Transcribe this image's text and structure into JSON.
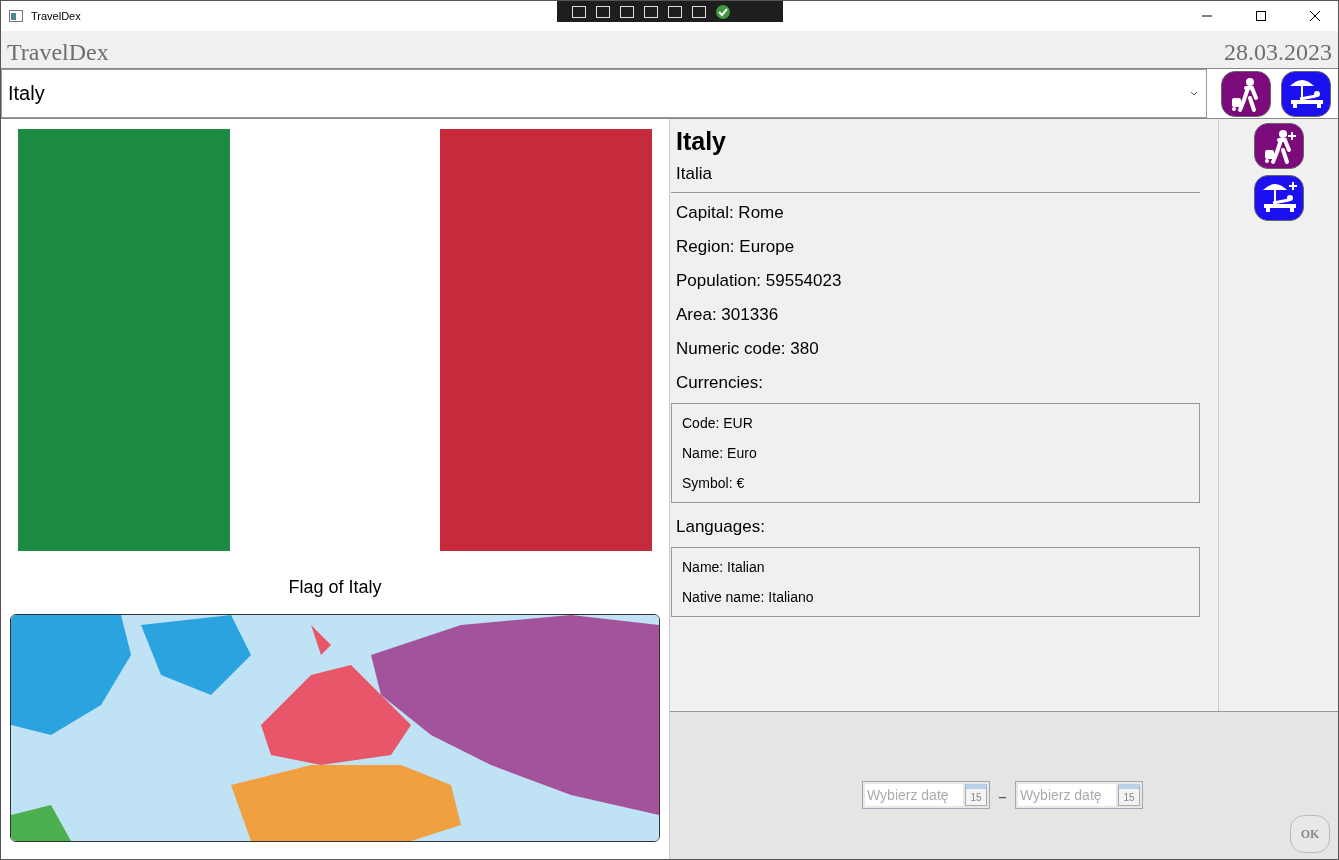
{
  "window": {
    "title": "TravelDex"
  },
  "header": {
    "app_name": "TravelDex",
    "date": "28.03.2023"
  },
  "country_select": {
    "value": "Italy"
  },
  "flag": {
    "caption": "Flag of Italy"
  },
  "details": {
    "name": "Italy",
    "native_name": "Italia",
    "facts": [
      "Capital: Rome",
      "Region: Europe",
      "Population: 59554023",
      "Area: 301336",
      "Numeric code: 380"
    ],
    "currencies_label": "Currencies:",
    "currencies": [
      [
        "Code: EUR",
        "Name: Euro",
        "Symbol: €"
      ]
    ],
    "languages_label": "Languages:",
    "languages": [
      [
        "Name: Italian",
        "Native name: Italiano"
      ]
    ]
  },
  "trip": {
    "start": {
      "placeholder": "Wybierz datę",
      "calendar_day": "15"
    },
    "separator": "–",
    "end": {
      "placeholder": "Wybierz datę",
      "calendar_day": "15"
    },
    "ok": "OK"
  }
}
